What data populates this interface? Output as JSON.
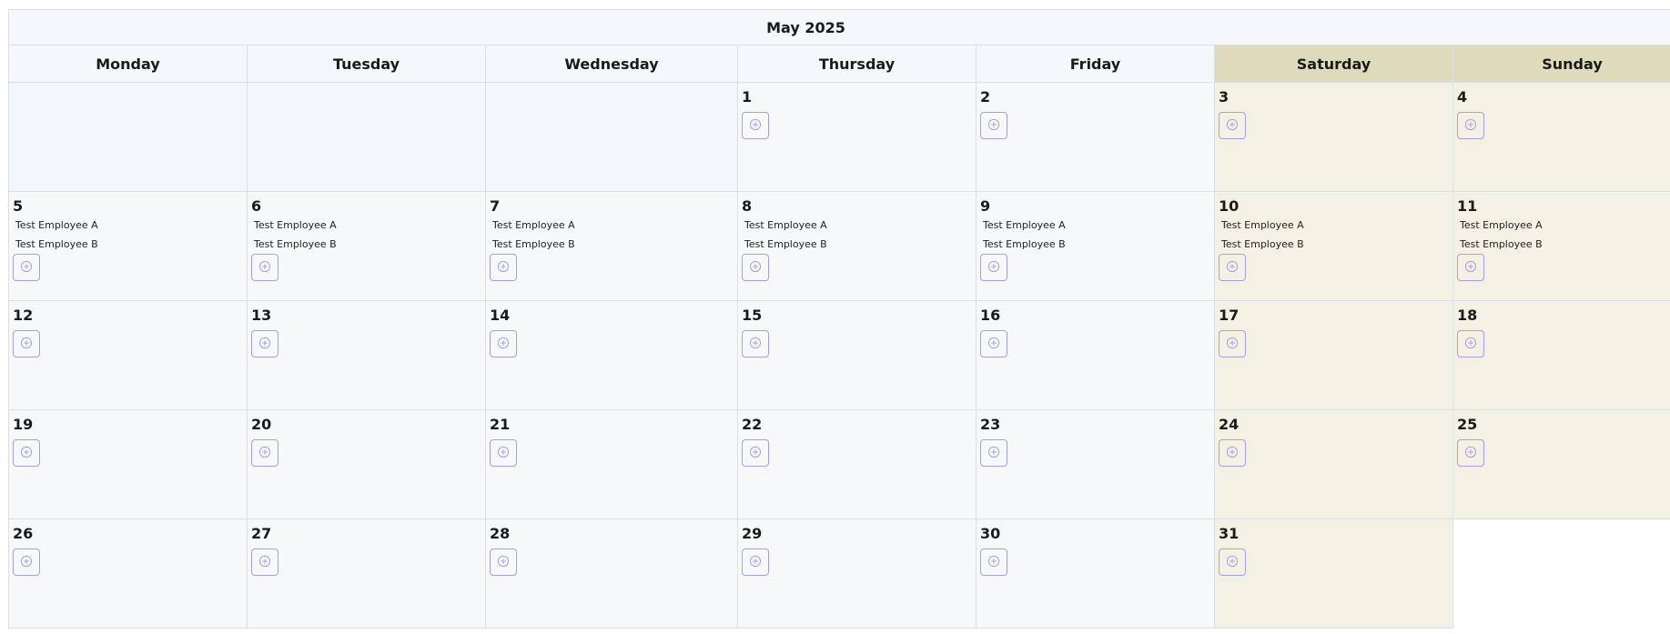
{
  "calendar": {
    "month_title": "May 2025",
    "weekdays": [
      "Monday",
      "Tuesday",
      "Wednesday",
      "Thursday",
      "Friday",
      "Saturday",
      "Sunday"
    ],
    "add_icon": "plus-circle-icon",
    "colors": {
      "accent": "#a89ee6",
      "weekend_header": "#dedbbd",
      "weekend_cell": "#f3f1e4",
      "weekday_cell": "#f7f8fa"
    },
    "weeks": [
      [
        null,
        null,
        null,
        {
          "day": "1",
          "employees": []
        },
        {
          "day": "2",
          "employees": []
        },
        {
          "day": "3",
          "employees": []
        },
        {
          "day": "4",
          "employees": []
        }
      ],
      [
        {
          "day": "5",
          "employees": [
            "Test Employee A",
            "Test Employee B"
          ]
        },
        {
          "day": "6",
          "employees": [
            "Test Employee A",
            "Test Employee B"
          ]
        },
        {
          "day": "7",
          "employees": [
            "Test Employee A",
            "Test Employee B"
          ]
        },
        {
          "day": "8",
          "employees": [
            "Test Employee A",
            "Test Employee B"
          ]
        },
        {
          "day": "9",
          "employees": [
            "Test Employee A",
            "Test Employee B"
          ]
        },
        {
          "day": "10",
          "employees": [
            "Test Employee A",
            "Test Employee B"
          ]
        },
        {
          "day": "11",
          "employees": [
            "Test Employee A",
            "Test Employee B"
          ]
        }
      ],
      [
        {
          "day": "12",
          "employees": []
        },
        {
          "day": "13",
          "employees": []
        },
        {
          "day": "14",
          "employees": []
        },
        {
          "day": "15",
          "employees": []
        },
        {
          "day": "16",
          "employees": []
        },
        {
          "day": "17",
          "employees": []
        },
        {
          "day": "18",
          "employees": []
        }
      ],
      [
        {
          "day": "19",
          "employees": []
        },
        {
          "day": "20",
          "employees": []
        },
        {
          "day": "21",
          "employees": []
        },
        {
          "day": "22",
          "employees": []
        },
        {
          "day": "23",
          "employees": []
        },
        {
          "day": "24",
          "employees": []
        },
        {
          "day": "25",
          "employees": []
        }
      ],
      [
        {
          "day": "26",
          "employees": []
        },
        {
          "day": "27",
          "employees": []
        },
        {
          "day": "28",
          "employees": []
        },
        {
          "day": "29",
          "employees": []
        },
        {
          "day": "30",
          "employees": []
        },
        {
          "day": "31",
          "employees": []
        },
        null
      ]
    ]
  }
}
